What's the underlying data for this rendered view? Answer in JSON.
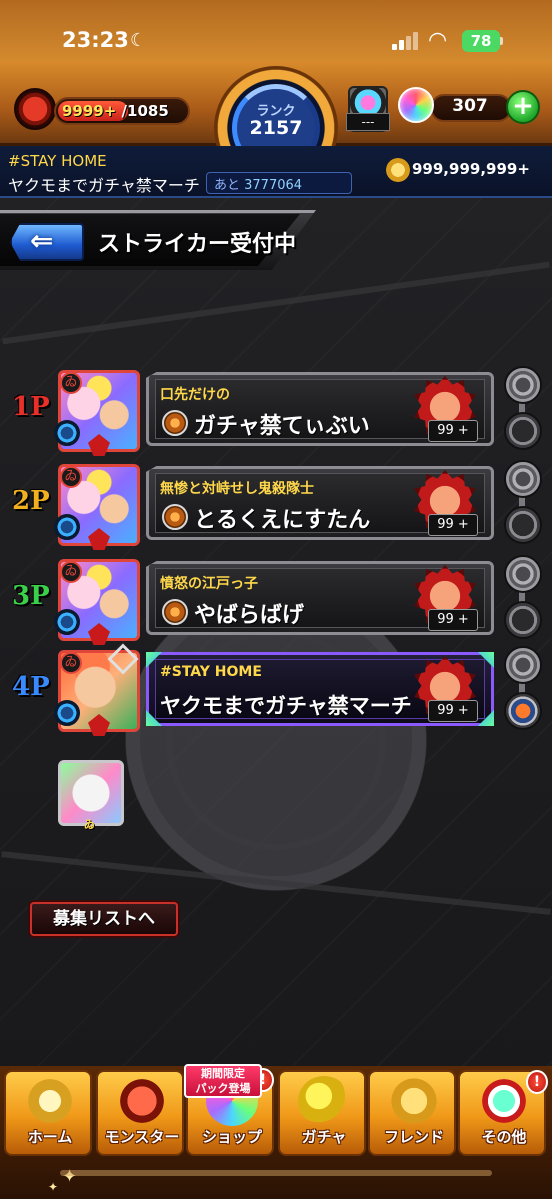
{
  "status_bar": {
    "time": "23:23",
    "battery": "78"
  },
  "header": {
    "stamina_current": "9999+",
    "stamina_max": " /1085",
    "rank_label": "ランク",
    "rank_value": "2157",
    "orb_slot_text": "---",
    "orb_count": "307",
    "orb_add": "+",
    "team_tag": "#STAY HOME",
    "team_name": "ヤクモまでガチャ禁マーチ",
    "next_label": "あと ",
    "next_value": "3777064",
    "coins": "999,999,999+"
  },
  "screen": {
    "back_icon": "back-arrow-icon",
    "title": "ストライカー受付中"
  },
  "players": [
    {
      "slot_label": "1P",
      "slot_color": "#e8302a",
      "title": "口先だけの",
      "name": "ガチャ禁てぃぶい",
      "level": "99 +",
      "avatar_badge": "ゐ",
      "highlight": false
    },
    {
      "slot_label": "2P",
      "slot_color": "#f0b020",
      "title": "無惨と対峙せし鬼殺隊士",
      "name": "とるくえにすたん",
      "level": "99 +",
      "avatar_badge": "ゐ",
      "highlight": false
    },
    {
      "slot_label": "3P",
      "slot_color": "#3ad04a",
      "title": "憤怒の江戸っ子",
      "name": "やばらばげ",
      "level": "99 +",
      "avatar_badge": "ゐ",
      "highlight": false
    },
    {
      "slot_label": "4P",
      "slot_color": "#3a8aff",
      "title": "#STAY HOME",
      "name": "ヤクモまでガチャ禁マーチ",
      "level": "99 +",
      "avatar_badge": "ゐ",
      "highlight": true
    }
  ],
  "helper": {
    "tag": "ゐ"
  },
  "recruit_button": "募集リストへ",
  "bottom_nav": {
    "items": [
      {
        "label": "ホーム",
        "icon": "home-icon"
      },
      {
        "label": "モンスター",
        "icon": "monster-icon"
      },
      {
        "label": "ショップ",
        "icon": "shop-icon"
      },
      {
        "label": "ガチャ",
        "icon": "gacha-icon"
      },
      {
        "label": "フレンド",
        "icon": "friend-icon"
      },
      {
        "label": "その他",
        "icon": "other-icon"
      }
    ],
    "shop_banner_line1": "期間限定",
    "shop_banner_line2": "パック登場",
    "alert": "!"
  },
  "colors": {
    "accent_orange": "#d88a2b",
    "accent_blue": "#1e5ad0",
    "highlight_purple": "#8a5aff",
    "level_bg": "#111111"
  }
}
